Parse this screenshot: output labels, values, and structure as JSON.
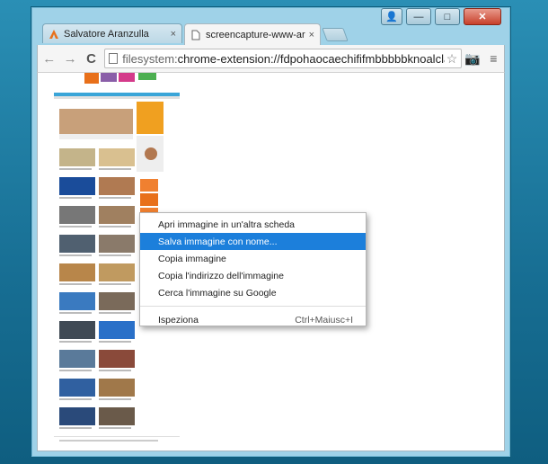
{
  "tabs": [
    {
      "title": "Salvatore Aranzulla",
      "close": "×"
    },
    {
      "title": "screencapture-www-aranz",
      "close": "×"
    }
  ],
  "toolbar": {
    "back": "←",
    "forward": "→",
    "reload": "C",
    "url_scheme": "filesystem:",
    "url_rest": "chrome-extension://fdpohaocaechififmbbbbbknoalcla",
    "star": "☆",
    "camera": "📷",
    "menu": "≡"
  },
  "window_controls": {
    "user": "👤",
    "minimize": "—",
    "maximize": "□",
    "close": "✕"
  },
  "context_menu": {
    "items": [
      {
        "label": "Apri immagine in un'altra scheda",
        "selected": false
      },
      {
        "label": "Salva immagine con nome...",
        "selected": true
      },
      {
        "label": "Copia immagine",
        "selected": false
      },
      {
        "label": "Copia l'indirizzo dell'immagine",
        "selected": false
      },
      {
        "label": "Cerca l'immagine su Google",
        "selected": false
      }
    ],
    "inspect": {
      "label": "Ispeziona",
      "shortcut": "Ctrl+Maiusc+I"
    }
  },
  "colors": {
    "selection": "#1c7fdb",
    "window_frame": "#9fd2e8",
    "close_button": "#c7402a"
  }
}
